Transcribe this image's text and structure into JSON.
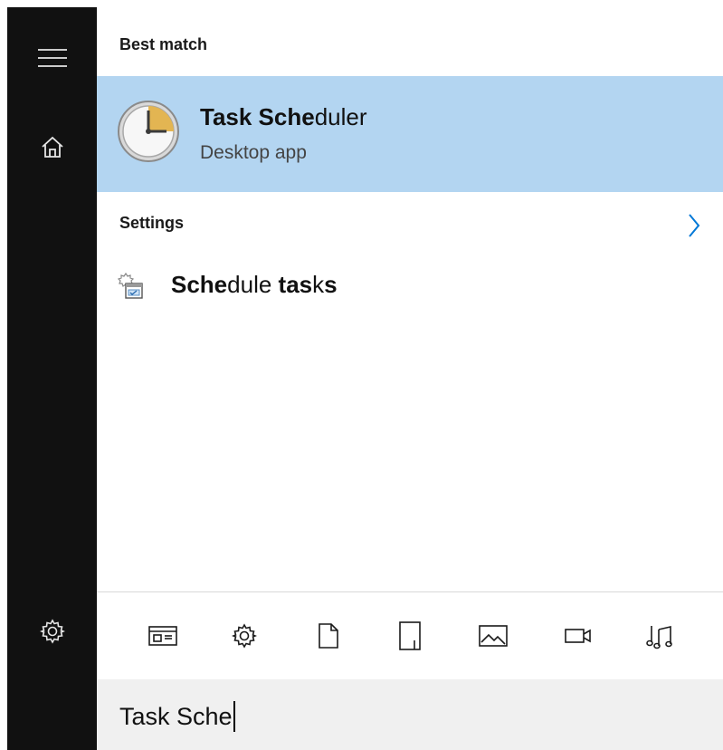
{
  "rail": {
    "items": [
      {
        "icon": "hamburger-menu-icon"
      },
      {
        "icon": "home-icon"
      },
      {
        "icon": "settings-gear-icon"
      }
    ]
  },
  "best_match": {
    "header": "Best match",
    "app": {
      "title_bold": "Task Sche",
      "title_rest": "duler",
      "subtitle": "Desktop app",
      "icon": "task-scheduler-clock-icon"
    }
  },
  "settings": {
    "header": "Settings",
    "items": [
      {
        "label_bold": "Sche",
        "label_mid": "dule ",
        "label_bold2": "tas",
        "label_end": "k",
        "label_bold3": "s",
        "icon": "schedule-tasks-icon"
      }
    ]
  },
  "filters": [
    {
      "icon": "apps-filter-icon"
    },
    {
      "icon": "settings-filter-icon"
    },
    {
      "icon": "documents-filter-icon"
    },
    {
      "icon": "folders-filter-icon"
    },
    {
      "icon": "photos-filter-icon"
    },
    {
      "icon": "videos-filter-icon"
    },
    {
      "icon": "music-filter-icon"
    }
  ],
  "search": {
    "value": "Task Sche"
  },
  "colors": {
    "rail": "#111111",
    "highlight": "#b3d5f1",
    "accent": "#0078d7",
    "search_bg": "#f0f0f0"
  }
}
